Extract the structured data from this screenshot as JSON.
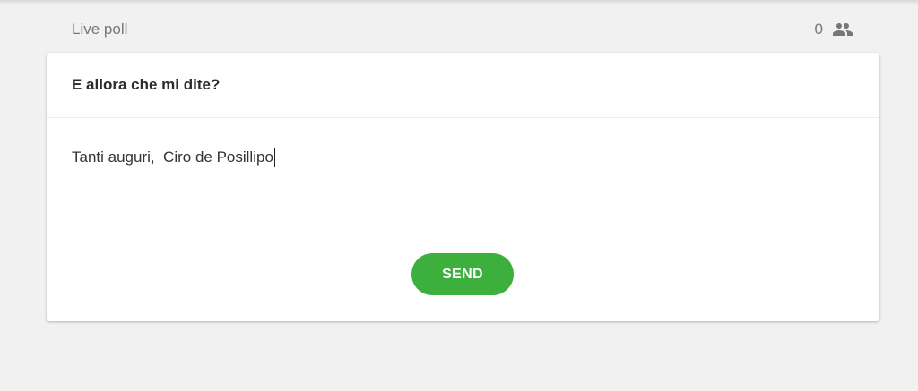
{
  "header": {
    "title": "Live poll",
    "participant_count": "0",
    "participant_icon": "people-icon"
  },
  "poll": {
    "question": "E allora che mi dite?",
    "answer_value": "Tanti auguri,  Ciro de Posillipo",
    "send_label": "SEND"
  },
  "colors": {
    "background": "#f1f1f1",
    "card": "#ffffff",
    "accent": "#3daf3d",
    "muted_text": "#777777"
  }
}
